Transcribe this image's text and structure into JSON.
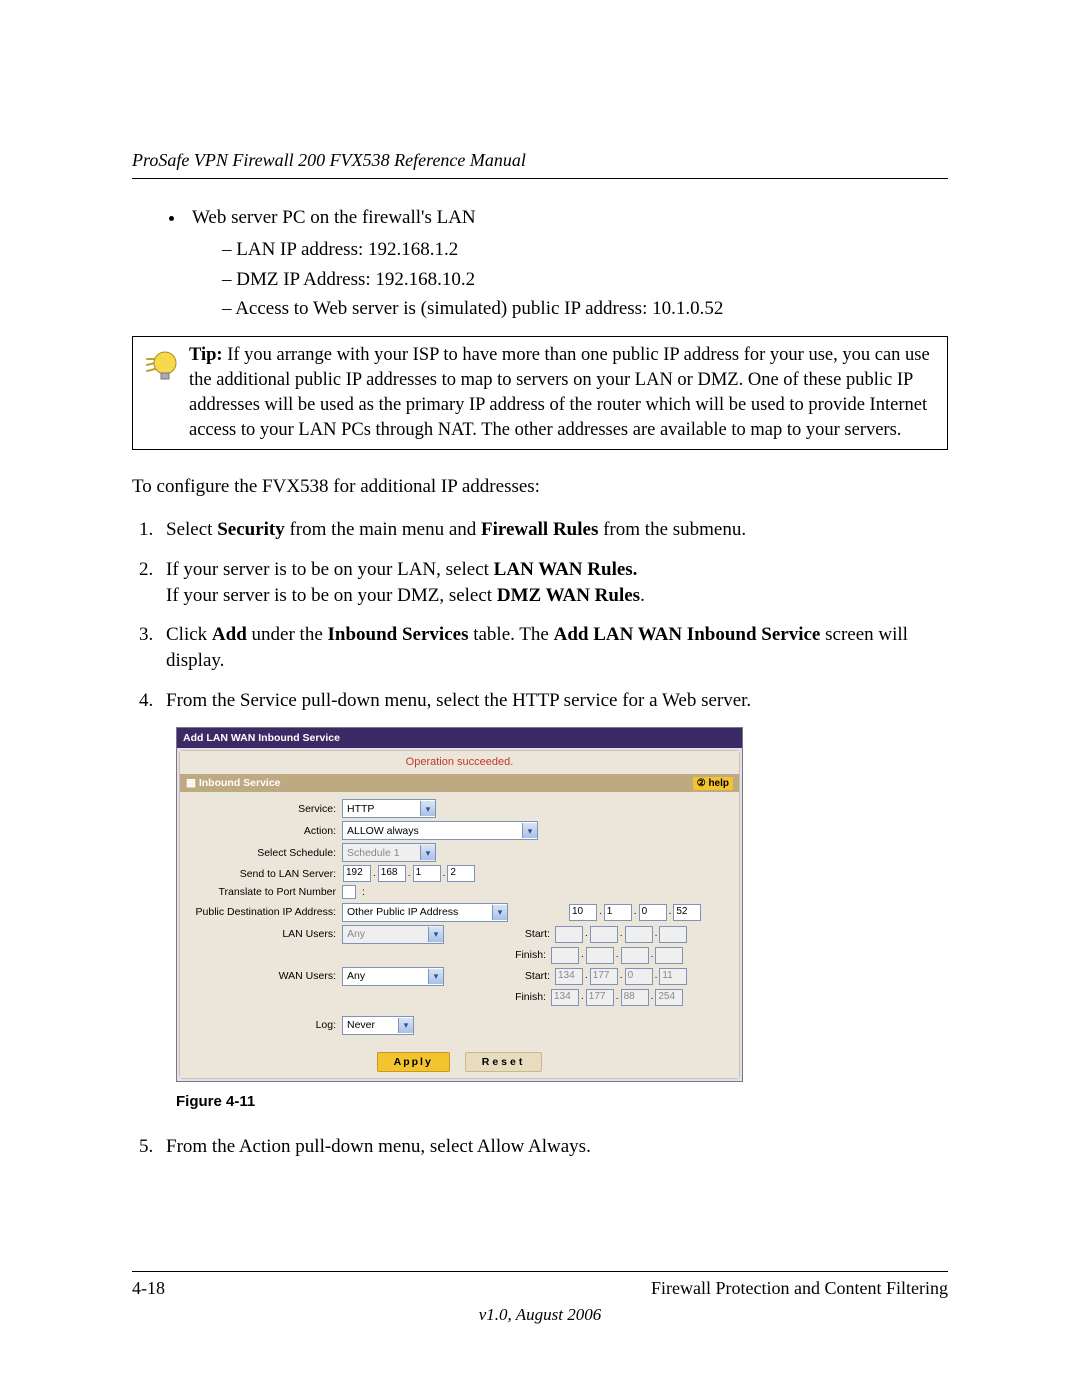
{
  "header": "ProSafe VPN Firewall 200 FVX538 Reference Manual",
  "bullet_main": "Web server PC on the firewall's LAN",
  "sub_bullets": [
    "LAN IP address: 192.168.1.2",
    "DMZ IP Address: 192.168.10.2",
    "Access to Web server is (simulated) public IP address: 10.1.0.52"
  ],
  "tip_prefix": "Tip:",
  "tip_body": " If you arrange with your ISP to have more than one public IP address for your use, you can use the additional public IP addresses to map to servers on your LAN or DMZ. One of these public IP addresses will be used as the primary IP address of the router which will be used to provide Internet access to your LAN PCs through NAT. The other addresses are available to map to your servers.",
  "configure_intro": "To configure the FVX538 for additional IP addresses:",
  "steps": {
    "s1a": "Select ",
    "s1b": "Security",
    "s1c": " from the main menu and ",
    "s1d": "Firewall Rules",
    "s1e": " from the submenu.",
    "s2a": "If your server is to be on your LAN, select ",
    "s2b": "LAN WAN Rules.",
    "s2br": "If your server is to be on your DMZ, select ",
    "s2c": "DMZ WAN Rules",
    "s3a": "Click ",
    "s3b": "Add",
    "s3c": " under the ",
    "s3d": "Inbound Services",
    "s3e": " table. The ",
    "s3f": "Add LAN WAN Inbound Service",
    "s3g": " screen will display.",
    "s4": "From the Service pull-down menu, select the HTTP service for a Web server.",
    "s5a": "From the Action pull-down menu, select Allow Always."
  },
  "figure_caption": "Figure 4-11",
  "ui": {
    "title": "Add LAN WAN Inbound Service",
    "message": "Operation succeeded.",
    "section_title": "Inbound Service",
    "help": "help",
    "labels": {
      "service": "Service:",
      "action": "Action:",
      "schedule": "Select Schedule:",
      "sendto": "Send to LAN Server:",
      "translate": "Translate to Port Number",
      "pubdest": "Public Destination IP Address:",
      "lanusers": "LAN Users:",
      "wanusers": "WAN Users:",
      "log": "Log:",
      "start": "Start:",
      "finish": "Finish:"
    },
    "values": {
      "service": "HTTP",
      "action": "ALLOW always",
      "schedule": "Schedule 1",
      "sendto": [
        "192",
        "168",
        "1",
        "2"
      ],
      "pubdest": "Other Public IP Address",
      "pubdest_ip": [
        "10",
        "1",
        "0",
        "52"
      ],
      "lanusers": "Any",
      "wanusers": "Any",
      "wan_start": [
        "134",
        "177",
        "0",
        "11"
      ],
      "wan_finish": [
        "134",
        "177",
        "88",
        "254"
      ],
      "log": "Never"
    },
    "buttons": {
      "apply": "Apply",
      "reset": "Reset"
    }
  },
  "footer": {
    "page": "4-18",
    "chapter": "Firewall Protection and Content Filtering",
    "version": "v1.0, August 2006"
  }
}
